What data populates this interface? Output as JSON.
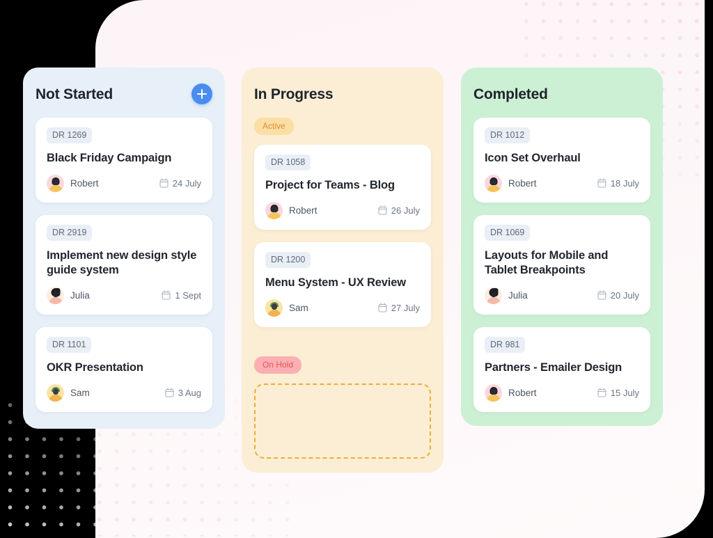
{
  "colors": {
    "not_started_bg": "#e7eff9",
    "in_progress_bg": "#fbeed4",
    "completed_bg": "#ccf0d4",
    "add_button": "#4a8cf0",
    "pill_active_bg": "#fadfa5",
    "pill_active_text": "#e08b2a",
    "pill_onhold_bg": "#fbafb2",
    "pill_onhold_text": "#e2575c",
    "card_bg": "#ffffff",
    "card_id_bg": "#eaeef5",
    "dropzone_border": "#edad36",
    "page_bg": "#fdf4f7",
    "dots": "#fbdde5"
  },
  "board": {
    "columns": [
      {
        "id": "not-started",
        "title": "Not Started",
        "add_label": "plus-icon",
        "has_add_button": true,
        "groups": [
          {
            "pill": null,
            "cards": [
              {
                "ticket": "DR 1269",
                "title": "Black Friday Campaign",
                "assignee": "Robert",
                "avatar": "avatar-robert",
                "due": "24 July",
                "due_icon": "calendar-icon"
              },
              {
                "ticket": "DR 2919",
                "title": "Implement new design style guide system",
                "assignee": "Julia",
                "avatar": "avatar-julia",
                "due": "1 Sept",
                "due_icon": "calendar-icon"
              },
              {
                "ticket": "DR 1101",
                "title": "OKR Presentation",
                "assignee": "Sam",
                "avatar": "avatar-sam",
                "due": "3 Aug",
                "due_icon": "calendar-icon"
              }
            ]
          }
        ]
      },
      {
        "id": "in-progress",
        "title": "In Progress",
        "has_add_button": false,
        "groups": [
          {
            "pill": "Active",
            "pill_style": "active",
            "cards": [
              {
                "ticket": "DR 1058",
                "title": "Project for Teams - Blog",
                "assignee": "Robert",
                "avatar": "avatar-robert",
                "due": "26 July",
                "due_icon": "calendar-icon"
              },
              {
                "ticket": "DR 1200",
                "title": "Menu System - UX Review",
                "assignee": "Sam",
                "avatar": "avatar-sam",
                "due": "27 July",
                "due_icon": "calendar-icon"
              }
            ]
          },
          {
            "pill": "On Hold",
            "pill_style": "onhold",
            "cards": [],
            "dropzone": true
          }
        ]
      },
      {
        "id": "completed",
        "title": "Completed",
        "has_add_button": false,
        "groups": [
          {
            "pill": null,
            "cards": [
              {
                "ticket": "DR 1012",
                "title": "Icon Set Overhaul",
                "assignee": "Robert",
                "avatar": "avatar-robert",
                "due": "18 July",
                "due_icon": "calendar-icon"
              },
              {
                "ticket": "DR 1069",
                "title": "Layouts for Mobile and Tablet Breakpoints",
                "assignee": "Julia",
                "avatar": "avatar-julia",
                "due": "20 July",
                "due_icon": "calendar-icon"
              },
              {
                "ticket": "DR 981",
                "title": "Partners - Emailer Design",
                "assignee": "Robert",
                "avatar": "avatar-robert",
                "due": "15 July",
                "due_icon": "calendar-icon"
              }
            ]
          }
        ]
      }
    ]
  }
}
